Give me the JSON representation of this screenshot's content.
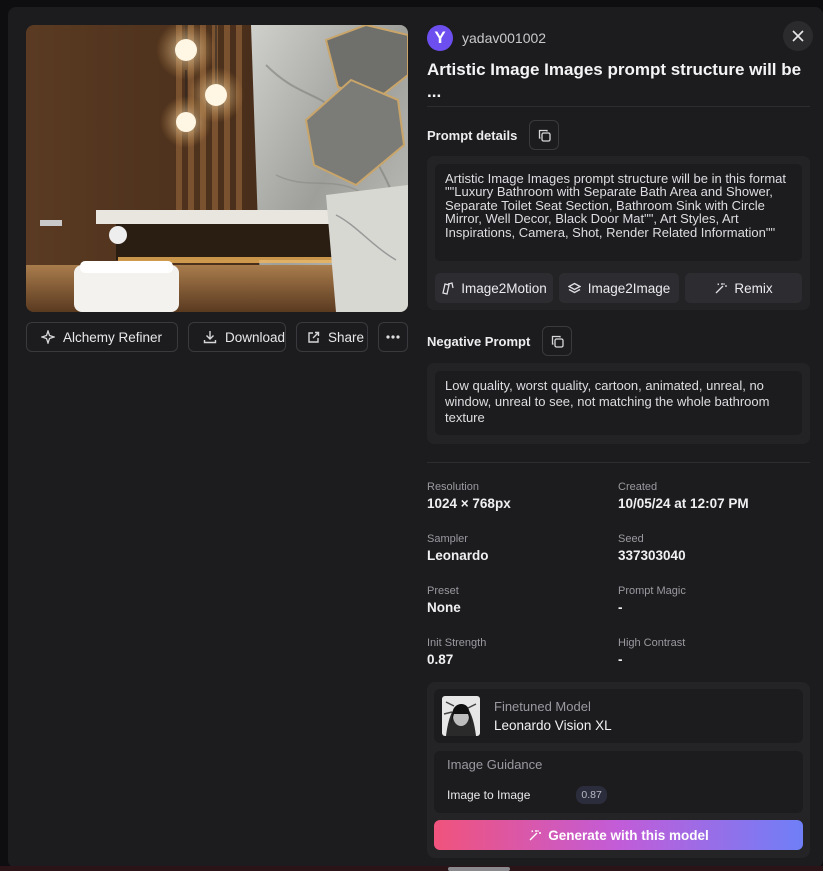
{
  "author": {
    "initial": "Y",
    "name": "yadav001002"
  },
  "title": "Artistic Image Images prompt structure will be ...",
  "image_actions": {
    "alchemy_refiner": "Alchemy Refiner",
    "download": "Download",
    "share": "Share"
  },
  "prompt": {
    "heading": "Prompt details",
    "text": "Artistic Image Images prompt structure will be in this format \"\"Luxury Bathroom with Separate Bath Area and Shower, Separate Toilet Seat Section, Bathroom Sink with Circle Mirror, Well Decor, Black Door Mat\"\", Art Styles, Art Inspirations, Camera, Shot, Render Related Information\"\"",
    "tools": [
      "Image2Motion",
      "Image2Image",
      "Remix"
    ]
  },
  "negative_prompt": {
    "heading": "Negative Prompt",
    "text": "Low quality, worst quality, cartoon, animated, unreal, no window, unreal to see, not matching the whole bathroom texture"
  },
  "meta": [
    {
      "label": "Resolution",
      "value": "1024 × 768px"
    },
    {
      "label": "Created",
      "value": "10/05/24 at 12:07 PM"
    },
    {
      "label": "Sampler",
      "value": "Leonardo"
    },
    {
      "label": "Seed",
      "value": "337303040"
    },
    {
      "label": "Preset",
      "value": "None"
    },
    {
      "label": "Prompt Magic",
      "value": "-"
    },
    {
      "label": "Init Strength",
      "value": "0.87"
    },
    {
      "label": "High Contrast",
      "value": "-"
    }
  ],
  "model": {
    "label": "Finetuned Model",
    "name": "Leonardo Vision XL"
  },
  "guidance": {
    "title": "Image Guidance",
    "key": "Image to Image",
    "value": "0.87"
  },
  "generate_label": "Generate with this model",
  "colors": {
    "accent_avatar": "#6d4ff0",
    "gradient_start": "#f0537c",
    "gradient_end": "#6f7ff7"
  }
}
